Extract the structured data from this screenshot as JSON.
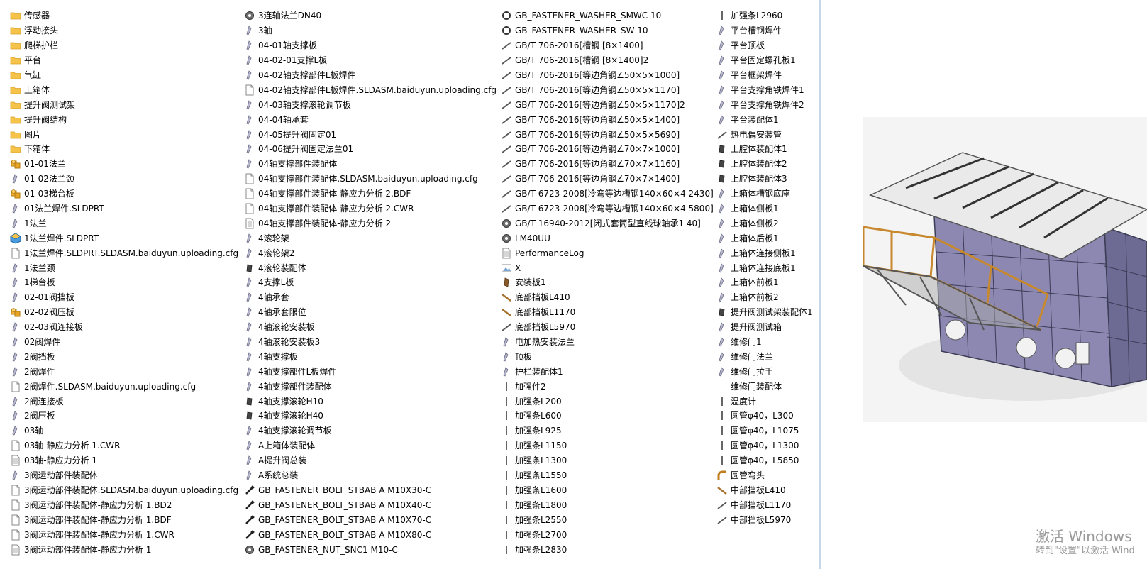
{
  "columns": [
    [
      {
        "label": "传感器",
        "icon": "folder"
      },
      {
        "label": "浮动接头",
        "icon": "folder"
      },
      {
        "label": "爬梯护栏",
        "icon": "folder"
      },
      {
        "label": "平台",
        "icon": "folder"
      },
      {
        "label": "气缸",
        "icon": "folder"
      },
      {
        "label": "上箱体",
        "icon": "folder"
      },
      {
        "label": "提升阀测试架",
        "icon": "folder"
      },
      {
        "label": "提升阀结构",
        "icon": "folder"
      },
      {
        "label": "图片",
        "icon": "folder"
      },
      {
        "label": "下箱体",
        "icon": "folder"
      },
      {
        "label": "01-01法兰",
        "icon": "assembly"
      },
      {
        "label": "01-02法兰颈",
        "icon": "part"
      },
      {
        "label": "01-03梯台板",
        "icon": "assembly"
      },
      {
        "label": "01法兰焊件.SLDPRT",
        "icon": "part"
      },
      {
        "label": "1法兰",
        "icon": "part"
      },
      {
        "label": "1法兰焊件.SLDPRT",
        "icon": "assembly-color"
      },
      {
        "label": "1法兰焊件.SLDPRT.SLDASM.baiduyun.uploading.cfg",
        "icon": "file"
      },
      {
        "label": "1法兰颈",
        "icon": "part"
      },
      {
        "label": "1梯台板",
        "icon": "part"
      },
      {
        "label": "02-01阀挡板",
        "icon": "part"
      },
      {
        "label": "02-02阀压板",
        "icon": "assembly"
      },
      {
        "label": "02-03阀连接板",
        "icon": "part"
      },
      {
        "label": "02阀焊件",
        "icon": "part"
      },
      {
        "label": "2阀挡板",
        "icon": "part"
      },
      {
        "label": "2阀焊件",
        "icon": "part"
      },
      {
        "label": "2阀焊件.SLDASM.baiduyun.uploading.cfg",
        "icon": "file"
      },
      {
        "label": "2阀连接板",
        "icon": "part"
      },
      {
        "label": "2阀压板",
        "icon": "part"
      },
      {
        "label": "03轴",
        "icon": "part"
      },
      {
        "label": "03轴-静应力分析 1.CWR",
        "icon": "file"
      },
      {
        "label": "03轴-静应力分析 1",
        "icon": "doc"
      },
      {
        "label": "3阀运动部件装配体",
        "icon": "part"
      },
      {
        "label": "3阀运动部件装配体.SLDASM.baiduyun.uploading.cfg",
        "icon": "file"
      },
      {
        "label": "3阀运动部件装配体-静应力分析 1.BD2",
        "icon": "file"
      },
      {
        "label": "3阀运动部件装配体-静应力分析 1.BDF",
        "icon": "file"
      },
      {
        "label": "3阀运动部件装配体-静应力分析 1.CWR",
        "icon": "file"
      },
      {
        "label": "3阀运动部件装配体-静应力分析 1",
        "icon": "doc"
      }
    ],
    [
      {
        "label": "3连轴法兰DN40",
        "icon": "gear"
      },
      {
        "label": "3轴",
        "icon": "part"
      },
      {
        "label": "04-01轴支撑板",
        "icon": "part"
      },
      {
        "label": "04-02-01支撑L板",
        "icon": "part"
      },
      {
        "label": "04-02轴支撑部件L板焊件",
        "icon": "part"
      },
      {
        "label": "04-02轴支撑部件L板焊件.SLDASM.baiduyun.uploading.cfg",
        "icon": "file"
      },
      {
        "label": "04-03轴支撑滚轮调节板",
        "icon": "part"
      },
      {
        "label": "04-04轴承套",
        "icon": "part"
      },
      {
        "label": "04-05提升阀固定01",
        "icon": "part"
      },
      {
        "label": "04-06提升阀固定法兰01",
        "icon": "part"
      },
      {
        "label": "04轴支撑部件装配体",
        "icon": "part"
      },
      {
        "label": "04轴支撑部件装配体.SLDASM.baiduyun.uploading.cfg",
        "icon": "file"
      },
      {
        "label": "04轴支撑部件装配体-静应力分析 2.BDF",
        "icon": "file"
      },
      {
        "label": "04轴支撑部件装配体-静应力分析 2.CWR",
        "icon": "file"
      },
      {
        "label": "04轴支撑部件装配体-静应力分析 2",
        "icon": "doc"
      },
      {
        "label": "4滚轮架",
        "icon": "part"
      },
      {
        "label": "4滚轮架2",
        "icon": "part"
      },
      {
        "label": "4滚轮装配体",
        "icon": "part-dark"
      },
      {
        "label": "4支撑L板",
        "icon": "part"
      },
      {
        "label": "4轴承套",
        "icon": "part"
      },
      {
        "label": "4轴承套限位",
        "icon": "part"
      },
      {
        "label": "4轴滚轮安装板",
        "icon": "part"
      },
      {
        "label": "4轴滚轮安装板3",
        "icon": "part"
      },
      {
        "label": "4轴支撑板",
        "icon": "part"
      },
      {
        "label": "4轴支撑部件L板焊件",
        "icon": "part"
      },
      {
        "label": "4轴支撑部件装配体",
        "icon": "part"
      },
      {
        "label": "4轴支撑滚轮H10",
        "icon": "part-dark"
      },
      {
        "label": "4轴支撑滚轮H40",
        "icon": "part-dark"
      },
      {
        "label": "4轴支撑滚轮调节板",
        "icon": "part"
      },
      {
        "label": "A上箱体装配体",
        "icon": "part"
      },
      {
        "label": "A提升阀总装",
        "icon": "part"
      },
      {
        "label": "A系统总装",
        "icon": "part"
      },
      {
        "label": "GB_FASTENER_BOLT_STBAB A M10X30-C",
        "icon": "bolt"
      },
      {
        "label": "GB_FASTENER_BOLT_STBAB A M10X40-C",
        "icon": "bolt"
      },
      {
        "label": "GB_FASTENER_BOLT_STBAB A M10X70-C",
        "icon": "bolt"
      },
      {
        "label": "GB_FASTENER_BOLT_STBAB A M10X80-C",
        "icon": "bolt"
      },
      {
        "label": "GB_FASTENER_NUT_SNC1 M10-C",
        "icon": "gear"
      }
    ],
    [
      {
        "label": "GB_FASTENER_WASHER_SMWC 10",
        "icon": "ring"
      },
      {
        "label": "GB_FASTENER_WASHER_SW 10",
        "icon": "ring"
      },
      {
        "label": "GB/T 706-2016[槽钢  [8×1400]",
        "icon": "beam"
      },
      {
        "label": "GB/T 706-2016[槽钢  [8×1400]2",
        "icon": "beam"
      },
      {
        "label": "GB/T 706-2016[等边角钢∠50×5×1000]",
        "icon": "beam"
      },
      {
        "label": "GB/T 706-2016[等边角钢∠50×5×1170]",
        "icon": "beam"
      },
      {
        "label": "GB/T 706-2016[等边角钢∠50×5×1170]2",
        "icon": "beam"
      },
      {
        "label": "GB/T 706-2016[等边角钢∠50×5×1400]",
        "icon": "beam"
      },
      {
        "label": "GB/T 706-2016[等边角钢∠50×5×5690]",
        "icon": "beam"
      },
      {
        "label": "GB/T 706-2016[等边角钢∠70×7×1000]",
        "icon": "beam"
      },
      {
        "label": "GB/T 706-2016[等边角钢∠70×7×1160]",
        "icon": "beam"
      },
      {
        "label": "GB/T 706-2016[等边角钢∠70×7×1400]",
        "icon": "beam"
      },
      {
        "label": "GB/T 6723-2008[冷弯等边槽钢140×60×4 2430]",
        "icon": "beam"
      },
      {
        "label": "GB/T 6723-2008[冷弯等边槽钢140×60×4 5800]",
        "icon": "beam"
      },
      {
        "label": "GB/T 16940-2012[闭式套筒型直线球轴承1 40]",
        "icon": "gear"
      },
      {
        "label": "LM40UU",
        "icon": "gear"
      },
      {
        "label": "PerformanceLog",
        "icon": "doc"
      },
      {
        "label": "X",
        "icon": "image"
      },
      {
        "label": "安装板1",
        "icon": "brown"
      },
      {
        "label": "底部挡板L410",
        "icon": "brown-line"
      },
      {
        "label": "底部挡板L1170",
        "icon": "brown-line"
      },
      {
        "label": "底部挡板L5970",
        "icon": "beam"
      },
      {
        "label": "电加热安装法兰",
        "icon": "part"
      },
      {
        "label": "顶板",
        "icon": "part"
      },
      {
        "label": "护栏装配体1",
        "icon": "part"
      },
      {
        "label": "加强件2",
        "icon": "bar"
      },
      {
        "label": "加强条L200",
        "icon": "bar"
      },
      {
        "label": "加强条L600",
        "icon": "bar"
      },
      {
        "label": "加强条L925",
        "icon": "bar"
      },
      {
        "label": "加强条L1150",
        "icon": "bar"
      },
      {
        "label": "加强条L1300",
        "icon": "bar"
      },
      {
        "label": "加强条L1550",
        "icon": "bar"
      },
      {
        "label": "加强条L1600",
        "icon": "bar"
      },
      {
        "label": "加强条L1800",
        "icon": "bar"
      },
      {
        "label": "加强条L2550",
        "icon": "bar"
      },
      {
        "label": "加强条L2700",
        "icon": "bar"
      },
      {
        "label": "加强条L2830",
        "icon": "bar"
      }
    ],
    [
      {
        "label": "加强条L2960",
        "icon": "bar"
      },
      {
        "label": "平台槽钢焊件",
        "icon": "part"
      },
      {
        "label": "平台顶板",
        "icon": "part"
      },
      {
        "label": "平台固定螺孔板1",
        "icon": "part"
      },
      {
        "label": "平台框架焊件",
        "icon": "part"
      },
      {
        "label": "平台支撑角铁焊件1",
        "icon": "part"
      },
      {
        "label": "平台支撑角铁焊件2",
        "icon": "part"
      },
      {
        "label": "平台装配体1",
        "icon": "part"
      },
      {
        "label": "热电偶安装管",
        "icon": "beam"
      },
      {
        "label": "上腔体装配体1",
        "icon": "part-dark"
      },
      {
        "label": "上腔体装配体2",
        "icon": "part-dark"
      },
      {
        "label": "上腔体装配体3",
        "icon": "part-dark"
      },
      {
        "label": "上箱体槽钢底座",
        "icon": "part"
      },
      {
        "label": "上箱体侧板1",
        "icon": "part"
      },
      {
        "label": "上箱体侧板2",
        "icon": "part"
      },
      {
        "label": "上箱体后板1",
        "icon": "part"
      },
      {
        "label": "上箱体连接侧板1",
        "icon": "part"
      },
      {
        "label": "上箱体连接底板1",
        "icon": "part"
      },
      {
        "label": "上箱体前板1",
        "icon": "part"
      },
      {
        "label": "上箱体前板2",
        "icon": "part"
      },
      {
        "label": "提升阀测试架装配体1",
        "icon": "part-dark"
      },
      {
        "label": "提升阀测试箱",
        "icon": "part"
      },
      {
        "label": "维修门1",
        "icon": "part"
      },
      {
        "label": "维修门法兰",
        "icon": "part"
      },
      {
        "label": "维修门拉手",
        "icon": "part"
      },
      {
        "label": "维修门装配体",
        "icon": "none"
      },
      {
        "label": "温度计",
        "icon": "bar"
      },
      {
        "label": "圆管φ40，L300",
        "icon": "bar"
      },
      {
        "label": "圆管φ40，L1075",
        "icon": "bar"
      },
      {
        "label": "圆管φ40，L1300",
        "icon": "bar"
      },
      {
        "label": "圆管φ40，L5850",
        "icon": "bar"
      },
      {
        "label": "圆管弯头",
        "icon": "elbow"
      },
      {
        "label": "中部挡板L410",
        "icon": "brown-line"
      },
      {
        "label": "中部挡板L1170",
        "icon": "beam"
      },
      {
        "label": "中部挡板L5970",
        "icon": "beam"
      }
    ]
  ],
  "watermark": {
    "title": "激活 Windows",
    "subtitle": "转到\"设置\"以激活 Wind"
  }
}
